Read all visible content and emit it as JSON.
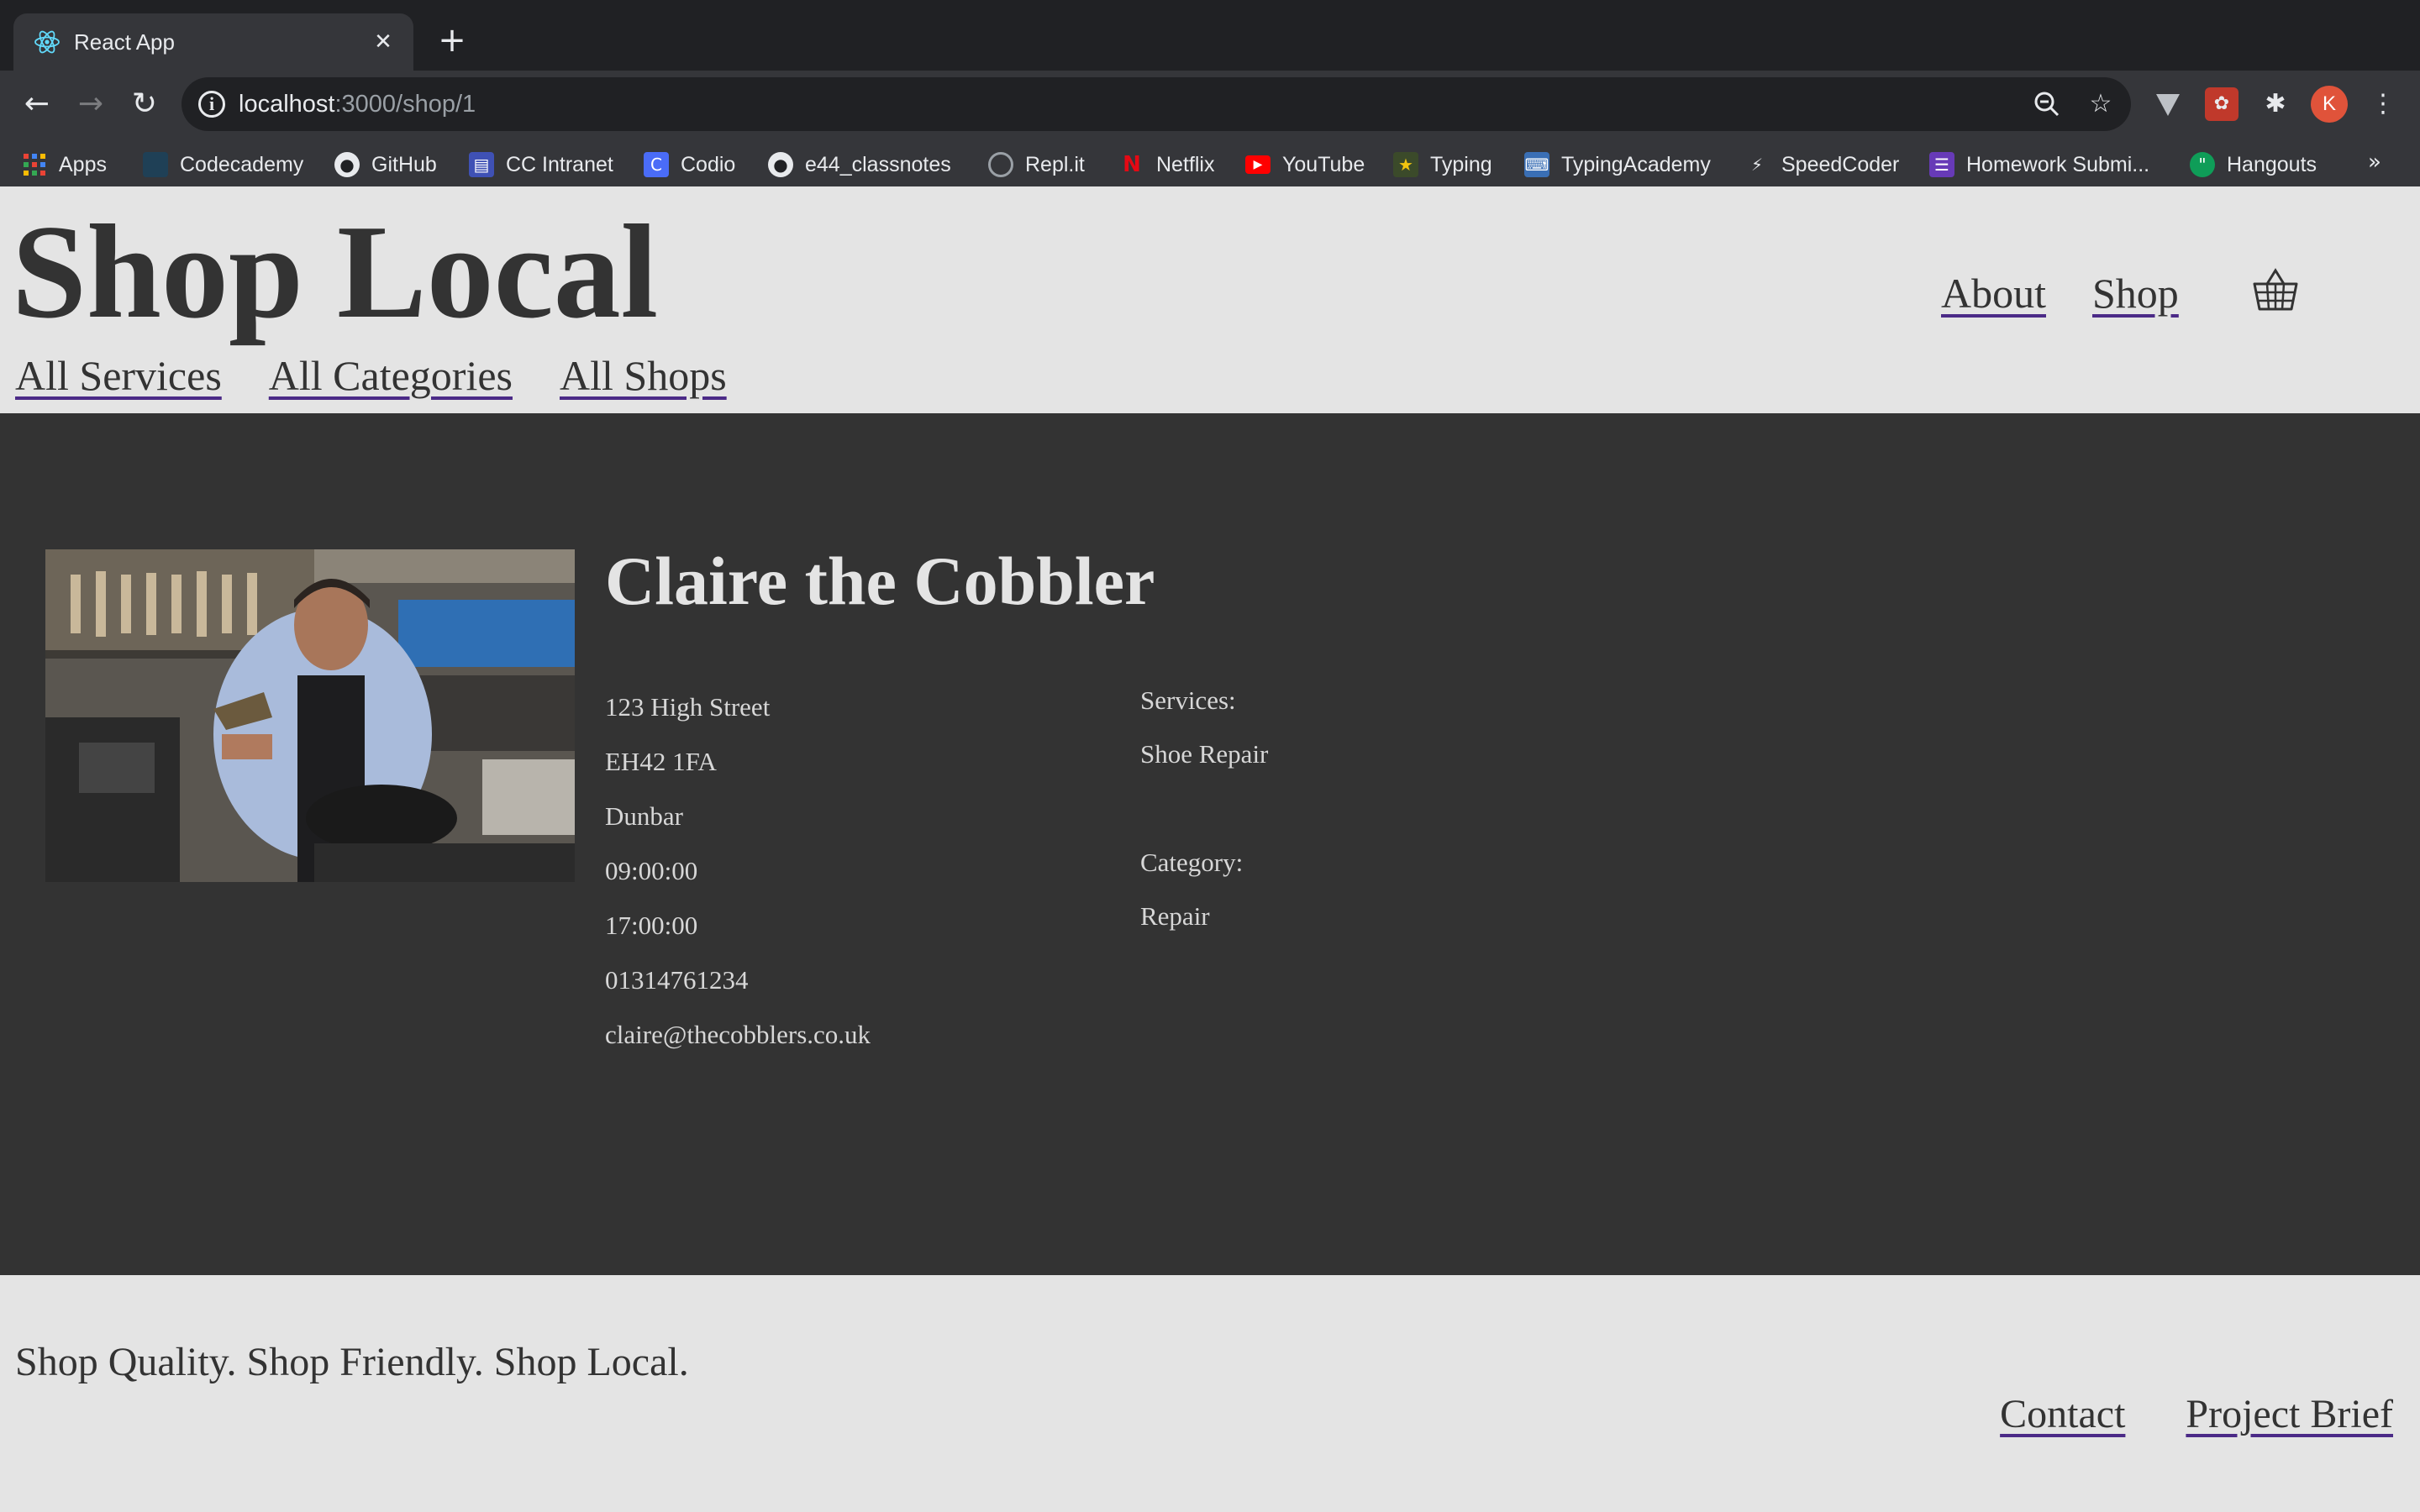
{
  "browser": {
    "tab_title": "React App",
    "url_host": "localhost",
    "url_path": ":3000/shop/1",
    "avatar_letter": "K",
    "bookmarks": [
      {
        "label": "Apps",
        "icon": "apps-grid-icon"
      },
      {
        "label": "Codecademy",
        "icon": "codecademy-icon"
      },
      {
        "label": "GitHub",
        "icon": "github-icon"
      },
      {
        "label": "CC Intranet",
        "icon": "cc-intranet-icon"
      },
      {
        "label": "Codio",
        "icon": "codio-icon"
      },
      {
        "label": "e44_classnotes",
        "icon": "github-icon"
      },
      {
        "label": "Repl.it",
        "icon": "replit-icon"
      },
      {
        "label": "Netflix",
        "icon": "netflix-icon"
      },
      {
        "label": "YouTube",
        "icon": "youtube-icon"
      },
      {
        "label": "Typing",
        "icon": "typing-icon"
      },
      {
        "label": "TypingAcademy",
        "icon": "typingacademy-icon"
      },
      {
        "label": "SpeedCoder",
        "icon": "speedcoder-icon"
      },
      {
        "label": "Homework Submi...",
        "icon": "homework-icon"
      },
      {
        "label": "Hangouts",
        "icon": "hangouts-icon"
      }
    ]
  },
  "header": {
    "site_title": "Shop Local",
    "nav": {
      "about": "About",
      "shop": "Shop"
    },
    "sub_nav": {
      "services": "All Services",
      "categories": "All Categories",
      "shops": "All Shops"
    }
  },
  "shop": {
    "name": "Claire the Cobbler",
    "address": "123 High Street",
    "postcode": "EH42 1FA",
    "town": "Dunbar",
    "opening_time": "09:00:00",
    "closing_time": "17:00:00",
    "phone": "01314761234",
    "email": "claire@thecobblers.co.uk",
    "services_label": "Services:",
    "services": "Shoe Repair",
    "category_label": "Category:",
    "category": "Repair"
  },
  "footer": {
    "tagline": "Shop Quality. Shop Friendly. Shop Local.",
    "contact": "Contact",
    "project_brief": "Project Brief"
  },
  "colors": {
    "header_bg": "#e4e4e4",
    "main_bg": "#333333",
    "text_dark": "#333333",
    "link_underline": "#4b2a87",
    "avatar": "#e0533a"
  }
}
